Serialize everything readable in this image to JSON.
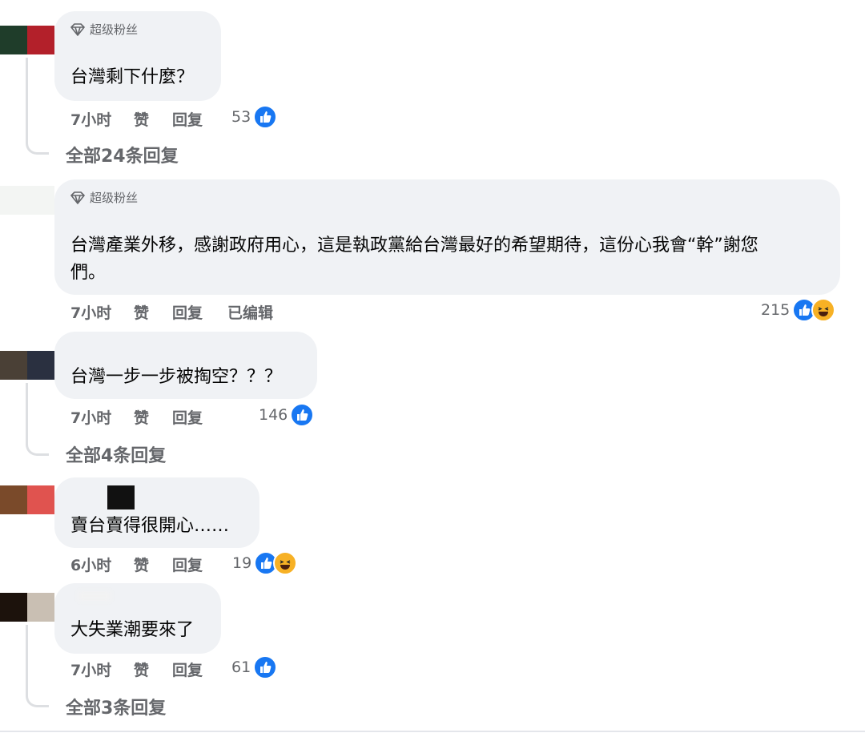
{
  "comments": [
    {
      "badge": "超级粉丝",
      "text": "台灣剩下什麼？",
      "time": "7小时",
      "like": "赞",
      "reply": "回复",
      "count": "53",
      "replies": "全部24条回复"
    },
    {
      "badge": "超级粉丝",
      "text_line1": "台灣產業外移，感謝政府用心，這是執政黨給台灣最好的希望期待，這份心我會“幹”謝您",
      "text_line2": "們。",
      "time": "7小时",
      "like": "赞",
      "reply": "回复",
      "edited": "已编辑",
      "count": "215"
    },
    {
      "text": "台灣一步一步被掏空？？？",
      "time": "7小时",
      "like": "赞",
      "reply": "回复",
      "count": "146",
      "replies": "全部4条回复"
    },
    {
      "text": "賣台賣得很開心……",
      "time": "6小时",
      "like": "赞",
      "reply": "回复",
      "count": "19"
    },
    {
      "text": "大失業潮要來了",
      "time": "7小时",
      "like": "赞",
      "reply": "回复",
      "count": "61",
      "replies": "全部3条回复"
    }
  ],
  "icons": {
    "badge": "diamond-icon",
    "like": "like-icon",
    "haha": "haha-icon"
  },
  "colors": {
    "like_blue": "#1877f2",
    "haha_yellow": "#f7b125",
    "bubble": "#f0f2f5",
    "meta_gray": "#65676b"
  }
}
